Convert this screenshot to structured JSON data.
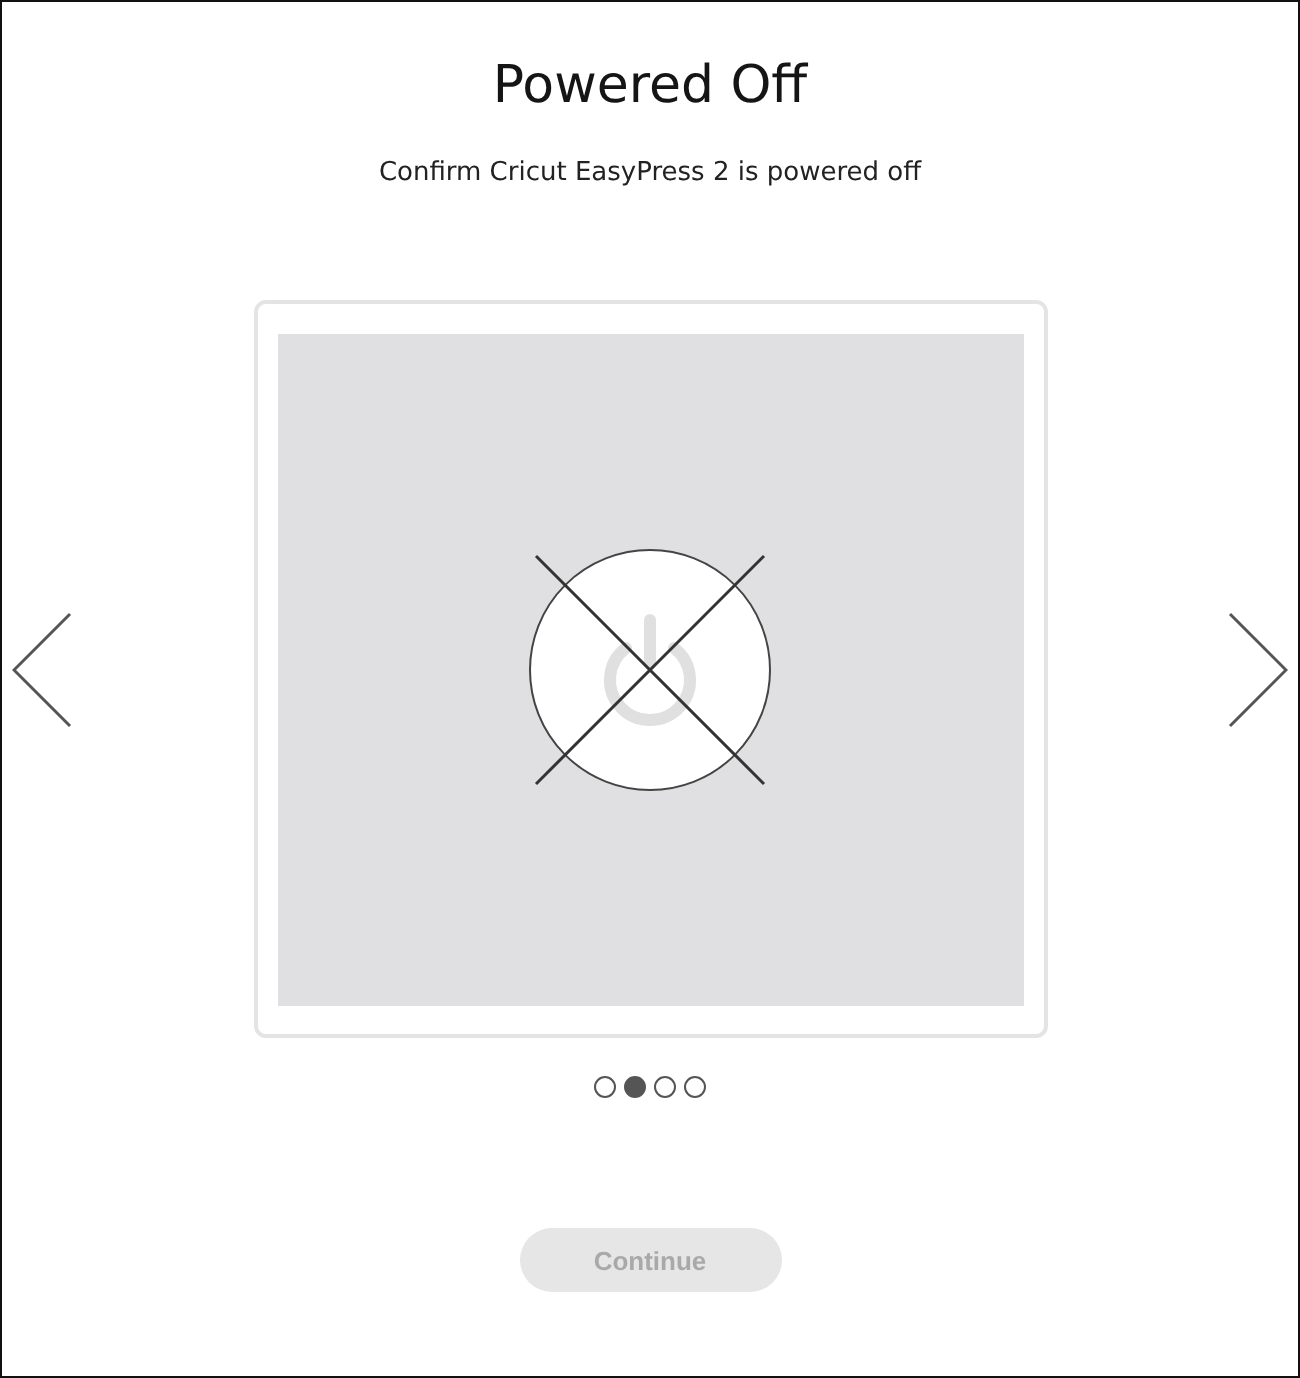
{
  "title": "Powered Off",
  "subtitle": "Confirm Cricut EasyPress 2 is powered off",
  "pages": [
    {
      "selected": false
    },
    {
      "selected": true
    },
    {
      "selected": false
    },
    {
      "selected": false
    }
  ],
  "continue_button": {
    "label": "Continue",
    "disabled": true
  }
}
